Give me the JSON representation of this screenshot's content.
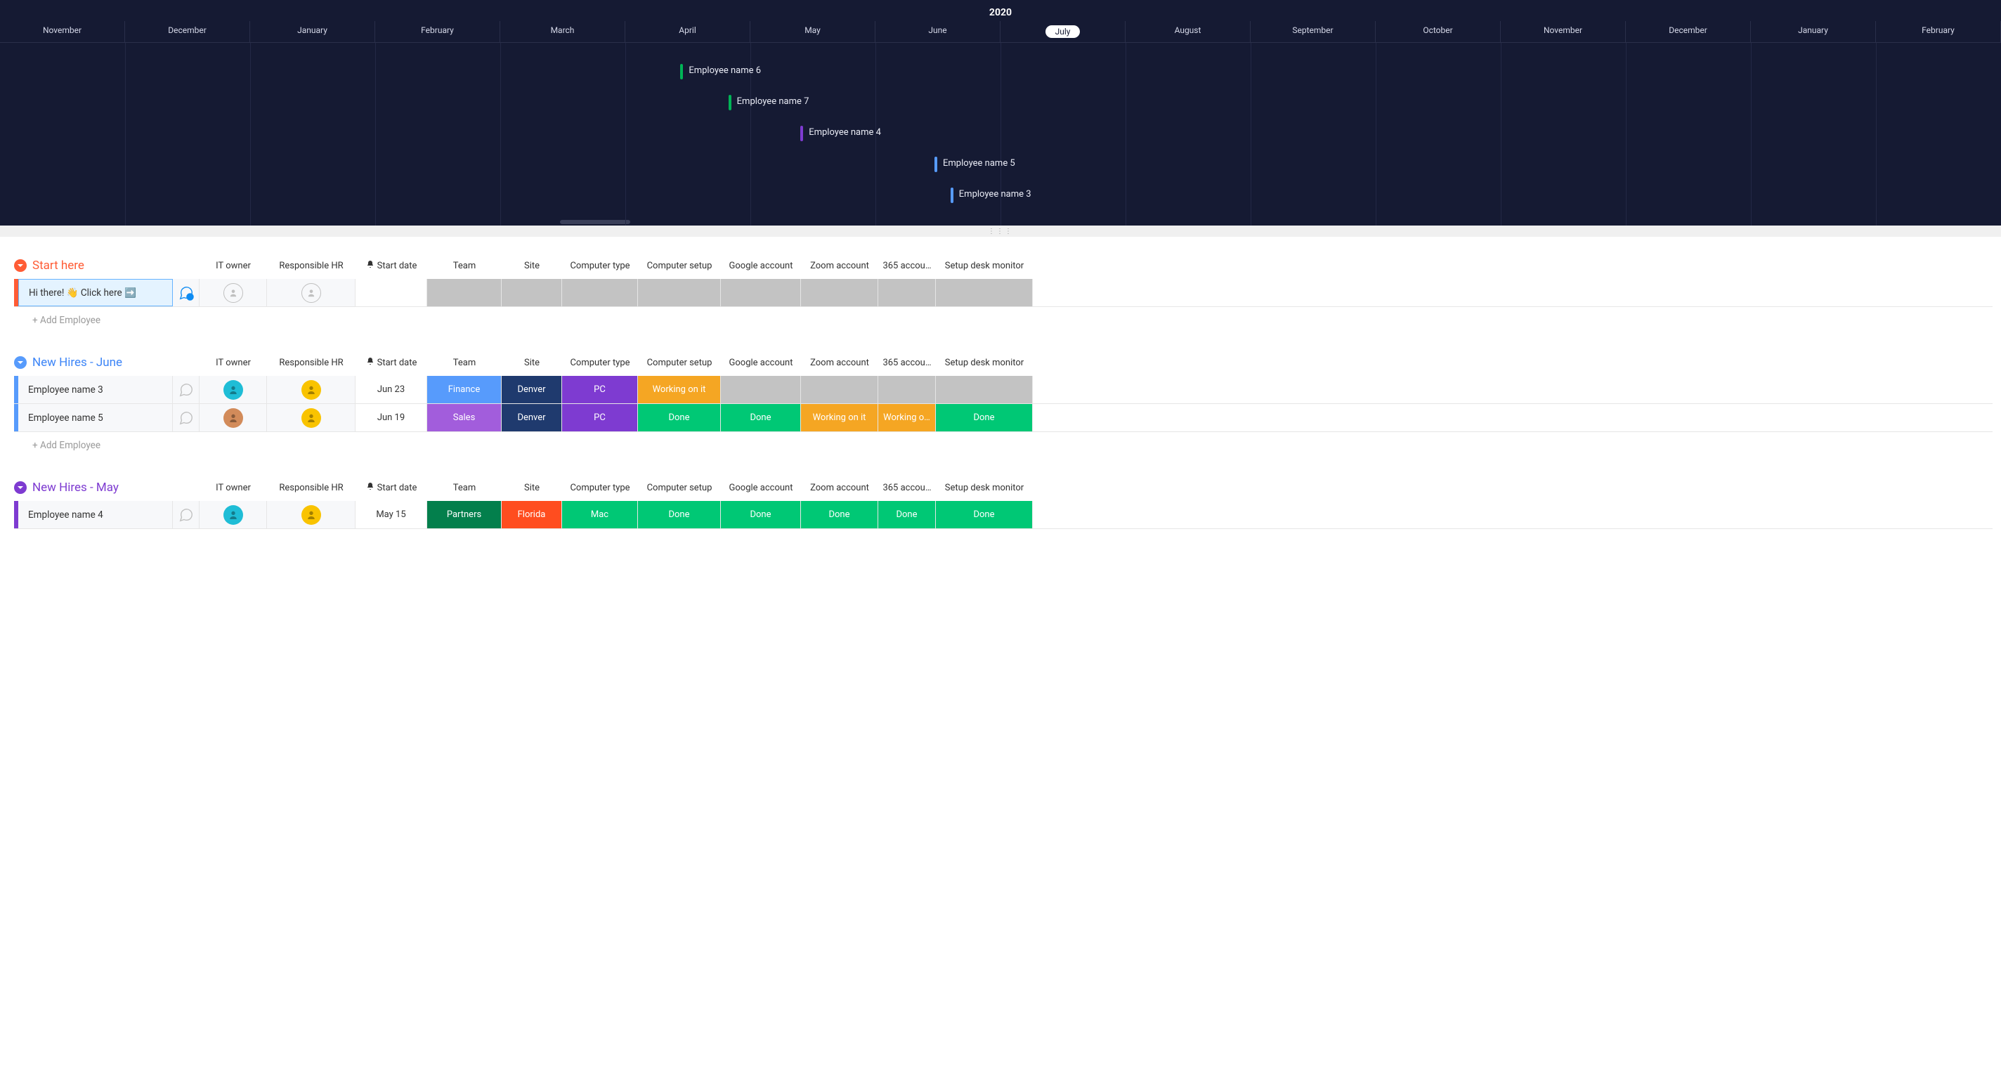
{
  "timeline": {
    "year": "2020",
    "months": [
      "November",
      "December",
      "January",
      "February",
      "March",
      "April",
      "May",
      "June",
      "July",
      "August",
      "September",
      "October",
      "November",
      "December",
      "January",
      "February"
    ],
    "currentIndex": 8,
    "bars": [
      {
        "label": "Employee name 6",
        "colPct": 34.0,
        "row": 0,
        "color": "#00b356"
      },
      {
        "label": "Employee name 7",
        "colPct": 36.4,
        "row": 1,
        "color": "#00b356"
      },
      {
        "label": "Employee name 4",
        "colPct": 40.0,
        "row": 2,
        "color": "#7e3bd1"
      },
      {
        "label": "Employee name 5",
        "colPct": 46.7,
        "row": 3,
        "color": "#579bfc"
      },
      {
        "label": "Employee name 3",
        "colPct": 47.5,
        "row": 4,
        "color": "#579bfc"
      }
    ]
  },
  "columns": [
    {
      "key": "it_owner",
      "label": "IT owner",
      "cls": "w-owner"
    },
    {
      "key": "hr",
      "label": "Responsible HR",
      "cls": "w-hr"
    },
    {
      "key": "start",
      "label": "Start date",
      "cls": "w-start",
      "bell": true
    },
    {
      "key": "team",
      "label": "Team",
      "cls": "w-team"
    },
    {
      "key": "site",
      "label": "Site",
      "cls": "w-site"
    },
    {
      "key": "ctype",
      "label": "Computer type",
      "cls": "w-ctype"
    },
    {
      "key": "csetup",
      "label": "Computer setup",
      "cls": "w-csetup"
    },
    {
      "key": "google",
      "label": "Google account",
      "cls": "w-google"
    },
    {
      "key": "zoom",
      "label": "Zoom account",
      "cls": "w-zoom"
    },
    {
      "key": "o365",
      "label": "365 accou…",
      "cls": "w-365"
    },
    {
      "key": "desk",
      "label": "Setup desk monitor",
      "cls": "w-desk"
    }
  ],
  "groups": [
    {
      "title": "Start here",
      "color": "#ff5c35",
      "titleColor": "#ff5c35",
      "rows": [
        {
          "name": "Hi there! 👋  Click here ➡️",
          "highlight": true,
          "chatBadge": "1",
          "cells": {
            "it_owner": {
              "avatar": "empty"
            },
            "hr": {
              "avatar": "empty"
            },
            "start": {
              "text": "",
              "style": "plain"
            },
            "team": {
              "style": "grey"
            },
            "site": {
              "style": "grey"
            },
            "ctype": {
              "style": "grey"
            },
            "csetup": {
              "style": "grey"
            },
            "google": {
              "style": "grey"
            },
            "zoom": {
              "style": "grey"
            },
            "o365": {
              "style": "grey"
            },
            "desk": {
              "style": "grey"
            }
          }
        }
      ],
      "addLabel": "+ Add Employee"
    },
    {
      "title": "New Hires - June",
      "color": "#579bfc",
      "titleColor": "#3d85f7",
      "rows": [
        {
          "name": "Employee name 3",
          "cells": {
            "it_owner": {
              "avatar": "#1fbdd6"
            },
            "hr": {
              "avatar": "#f9c300"
            },
            "start": {
              "text": "Jun 23",
              "style": "plain"
            },
            "team": {
              "text": "Finance",
              "bg": "bg-blue"
            },
            "site": {
              "text": "Denver",
              "bg": "bg-navy"
            },
            "ctype": {
              "text": "PC",
              "bg": "bg-purple"
            },
            "csetup": {
              "text": "Working on it",
              "bg": "bg-orange"
            },
            "google": {
              "style": "grey"
            },
            "zoom": {
              "style": "grey"
            },
            "o365": {
              "style": "grey"
            },
            "desk": {
              "style": "grey"
            }
          }
        },
        {
          "name": "Employee name 5",
          "cells": {
            "it_owner": {
              "avatar": "#d28b5a"
            },
            "hr": {
              "avatar": "#f9c300"
            },
            "start": {
              "text": "Jun 19",
              "style": "plain"
            },
            "team": {
              "text": "Sales",
              "bg": "bg-violet"
            },
            "site": {
              "text": "Denver",
              "bg": "bg-navy"
            },
            "ctype": {
              "text": "PC",
              "bg": "bg-purple"
            },
            "csetup": {
              "text": "Done",
              "bg": "bg-green"
            },
            "google": {
              "text": "Done",
              "bg": "bg-green"
            },
            "zoom": {
              "text": "Working on it",
              "bg": "bg-orange"
            },
            "o365": {
              "text": "Working o…",
              "bg": "bg-orange"
            },
            "desk": {
              "text": "Done",
              "bg": "bg-green"
            }
          }
        }
      ],
      "addLabel": "+ Add Employee"
    },
    {
      "title": "New Hires - May",
      "color": "#7e3bd1",
      "titleColor": "#7e3bd1",
      "rows": [
        {
          "name": "Employee name 4",
          "cells": {
            "it_owner": {
              "avatar": "#1fbdd6"
            },
            "hr": {
              "avatar": "#f9c300"
            },
            "start": {
              "text": "May 15",
              "style": "plain"
            },
            "team": {
              "text": "Partners",
              "bg": "bg-darkgreen"
            },
            "site": {
              "text": "Florida",
              "bg": "bg-red"
            },
            "ctype": {
              "text": "Mac",
              "bg": "bg-green"
            },
            "csetup": {
              "text": "Done",
              "bg": "bg-green"
            },
            "google": {
              "text": "Done",
              "bg": "bg-green"
            },
            "zoom": {
              "text": "Done",
              "bg": "bg-green"
            },
            "o365": {
              "text": "Done",
              "bg": "bg-green"
            },
            "desk": {
              "text": "Done",
              "bg": "bg-green"
            }
          }
        }
      ]
    }
  ]
}
